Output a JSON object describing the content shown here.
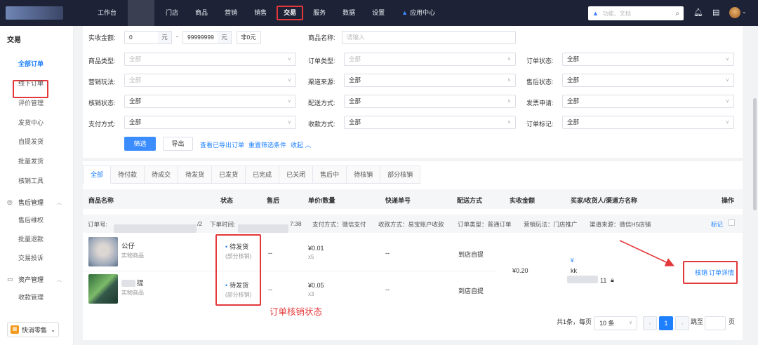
{
  "topbar": {
    "nav": [
      "工作台",
      "门店",
      "商品",
      "营销",
      "销售",
      "交易",
      "服务",
      "数据",
      "设置"
    ],
    "app_center": "应用中心",
    "search_placeholder": "功能、文档"
  },
  "sidebar": {
    "title": "交易",
    "items": [
      "全部订单",
      "线下订单",
      "评价管理",
      "发货中心",
      "自提发货",
      "批量发货",
      "核销工具"
    ],
    "group_after_sale": "售后管理",
    "after_sale_items": [
      "售后维权",
      "批量退款",
      "交易投诉"
    ],
    "group_assets": "资产管理",
    "asset_items": [
      "收款管理"
    ],
    "footer": "快消零售"
  },
  "filters": {
    "amount_label": "实收金额:",
    "amount_min": "0",
    "amount_max": "99999999",
    "unit": "元",
    "dash": "-",
    "non_zero": "非0元",
    "product_name_label": "商品名称:",
    "product_name_placeholder": "请输入",
    "product_type_label": "商品类型:",
    "order_type_label": "订单类型:",
    "order_status_label": "订单状态:",
    "marketing_label": "营销玩法:",
    "channel_label": "渠道来源:",
    "aftersale_status_label": "售后状态:",
    "verify_status_label": "核销状态:",
    "delivery_label": "配送方式:",
    "invoice_label": "发票申请:",
    "pay_method_label": "支付方式:",
    "collect_label": "收款方式:",
    "mark_label": "订单标记:",
    "all": "全部",
    "btn_filter": "筛选",
    "btn_export": "导出",
    "link_view_export": "查看已导出订单",
    "link_reset": "重置筛选条件",
    "link_collapse": "收起"
  },
  "tabs": [
    "全部",
    "待付款",
    "待成交",
    "待发货",
    "已发货",
    "已完成",
    "已关闭",
    "售后中",
    "待核销",
    "部分核销"
  ],
  "table": {
    "headers": [
      "商品名称",
      "状态",
      "售后",
      "单价/数量",
      "快递单号",
      "配送方式",
      "实收金额",
      "买家/收货人/渠道方名称",
      "操作"
    ],
    "order": {
      "order_no_label": "订单号:",
      "order_no_suffix": "/2",
      "time_label": "下单时间:",
      "time_suffix": "7:38",
      "pay": "支付方式：微信支付",
      "collect": "收款方式：易宝账户收款",
      "type": "订单类型：普通订单",
      "marketing": "营销玩法：门店推广",
      "channel": "渠道来源：微信H5店铺",
      "mark": "标记"
    },
    "rows": [
      {
        "name": "公仔",
        "type": "实物商品",
        "status": "待发货",
        "sub": "(部分核销)",
        "after": "--",
        "price": "¥0.01",
        "qty": "x5",
        "express": "--",
        "delivery": "到店自提"
      },
      {
        "name": "提",
        "type": "实物商品",
        "status": "待发货",
        "sub": "(部分核销)",
        "after": "--",
        "price": "¥0.05",
        "qty": "x3",
        "express": "--",
        "delivery": "到店自提"
      }
    ],
    "amount": "¥0.20",
    "buyer_icon": "¥",
    "buyer": "kk",
    "buyer_phone_suffix": "11",
    "actions": [
      "核销",
      "订单详情"
    ]
  },
  "annotation": "订单核销状态",
  "pagination": {
    "total": "共1条，每页",
    "size": "10 条",
    "current": "1",
    "goto": "跳至",
    "page_unit": "页"
  }
}
